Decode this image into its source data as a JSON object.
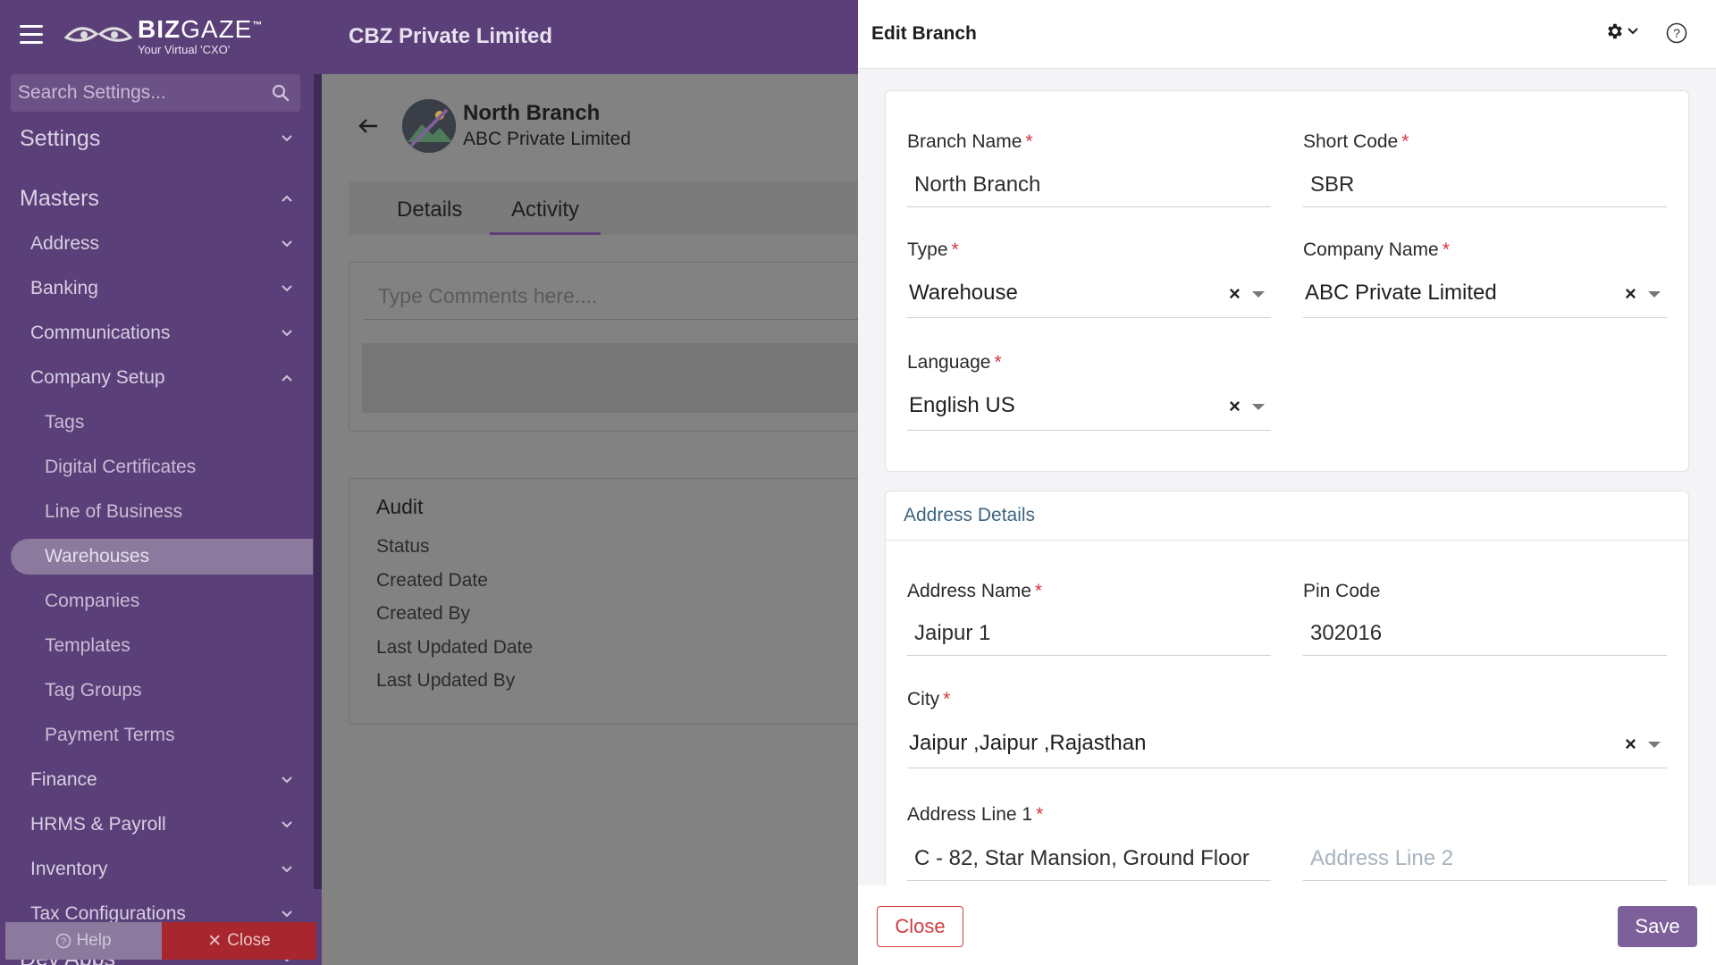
{
  "header": {
    "logo_main": "BIZ",
    "logo_main_thin": "GAZE",
    "logo_tm": "™",
    "logo_sub": "Your Virtual 'CXO'",
    "company": "CBZ Private Limited"
  },
  "sidebar": {
    "search_placeholder": "Search Settings...",
    "items": [
      {
        "label": "Settings",
        "level": 0,
        "expanded": false
      },
      {
        "label": "Masters",
        "level": 0,
        "expanded": true
      },
      {
        "label": "Address",
        "level": 1,
        "expanded": false
      },
      {
        "label": "Banking",
        "level": 1,
        "expanded": false
      },
      {
        "label": "Communications",
        "level": 1,
        "expanded": false
      },
      {
        "label": "Company Setup",
        "level": 1,
        "expanded": true
      },
      {
        "label": "Tags",
        "level": 2
      },
      {
        "label": "Digital Certificates",
        "level": 2
      },
      {
        "label": "Line of Business",
        "level": 2
      },
      {
        "label": "Warehouses",
        "level": 2,
        "active": true
      },
      {
        "label": "Companies",
        "level": 2
      },
      {
        "label": "Templates",
        "level": 2
      },
      {
        "label": "Tag Groups",
        "level": 2
      },
      {
        "label": "Payment Terms",
        "level": 2
      },
      {
        "label": "Finance",
        "level": 1,
        "expanded": false
      },
      {
        "label": "HRMS & Payroll",
        "level": 1,
        "expanded": false
      },
      {
        "label": "Inventory",
        "level": 1,
        "expanded": false
      },
      {
        "label": "Tax Configurations",
        "level": 1,
        "expanded": false
      },
      {
        "label": "Dev Apps",
        "level": 0,
        "expanded": false
      }
    ],
    "help_label": "Help",
    "close_label": "Close"
  },
  "main": {
    "branch_name": "North Branch",
    "branch_company": "ABC Private Limited",
    "tabs": [
      {
        "label": "Details",
        "active": false
      },
      {
        "label": "Activity",
        "active": true
      }
    ],
    "comment_placeholder": "Type Comments here....",
    "audit": {
      "title": "Audit",
      "rows": [
        "Status",
        "Created Date",
        "Created By",
        "Last Updated Date",
        "Last Updated By"
      ]
    }
  },
  "panel": {
    "title": "Edit Branch",
    "fields": {
      "branch_name": {
        "label": "Branch Name",
        "value": "North Branch"
      },
      "short_code": {
        "label": "Short Code",
        "value": "SBR"
      },
      "type": {
        "label": "Type",
        "value": "Warehouse"
      },
      "company_name": {
        "label": "Company Name",
        "value": "ABC Private Limited"
      },
      "language": {
        "label": "Language",
        "value": "English US"
      }
    },
    "address": {
      "section_title": "Address Details",
      "address_name": {
        "label": "Address Name",
        "value": "Jaipur 1"
      },
      "pin_code": {
        "label": "Pin Code",
        "value": "302016"
      },
      "city": {
        "label": "City",
        "value": "Jaipur ,Jaipur ,Rajasthan"
      },
      "address_line_1": {
        "label": "Address Line 1",
        "value": "C - 82, Star Mansion, Ground Floor"
      },
      "address_line_2": {
        "placeholder": "Address Line 2",
        "value": ""
      }
    },
    "required_mark": "*",
    "clear_glyph": "×",
    "close_label": "Close",
    "save_label": "Save"
  },
  "colors": {
    "brand_purple": "#5b3f78",
    "save_button": "#7d5f99",
    "close_button": "#d23b42",
    "required_asterisk": "#d6333c",
    "section_title": "#3d6480"
  },
  "icons": [
    "hamburger-icon",
    "search-icon",
    "chevron-down-icon",
    "chevron-up-icon",
    "back-arrow-icon",
    "gear-icon",
    "help-circle-icon",
    "clear-icon",
    "caret-down-icon"
  ]
}
